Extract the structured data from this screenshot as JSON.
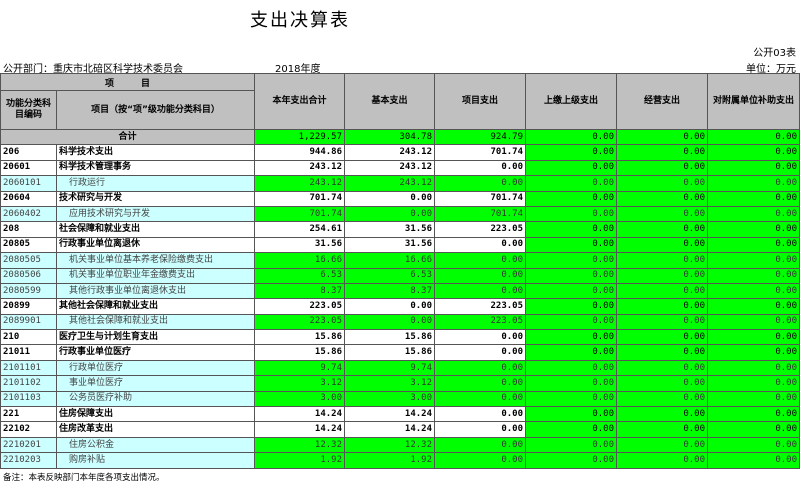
{
  "title": "支出决算表",
  "form_no": "公开03表",
  "department": "公开部门：重庆市北碚区科学技术委员会",
  "year": "2018年度",
  "unit": "单位：万元",
  "headers": {
    "item": "项　　　目",
    "code": "功能分类科目编码",
    "name": "项目（按“项”级功能分类科目）",
    "cols": [
      "本年支出合计",
      "基本支出",
      "项目支出",
      "上缴上级支出",
      "经营支出",
      "对附属单位补助支出"
    ]
  },
  "rows": [
    {
      "type": "total",
      "code": "",
      "name": "合计",
      "values": [
        "1,229.57",
        "304.78",
        "924.79",
        "0.00",
        "0.00",
        "0.00"
      ]
    },
    {
      "type": "cat",
      "code": "206",
      "name": "科学技术支出",
      "values": [
        "944.86",
        "243.12",
        "701.74",
        "0.00",
        "0.00",
        "0.00"
      ]
    },
    {
      "type": "cat",
      "code": "20601",
      "name": "科学技术管理事务",
      "values": [
        "243.12",
        "243.12",
        "0.00",
        "0.00",
        "0.00",
        "0.00"
      ]
    },
    {
      "type": "item",
      "code": "2060101",
      "name": "行政运行",
      "values": [
        "243.12",
        "243.12",
        "0.00",
        "0.00",
        "0.00",
        "0.00"
      ]
    },
    {
      "type": "cat",
      "code": "20604",
      "name": "技术研究与开发",
      "values": [
        "701.74",
        "0.00",
        "701.74",
        "0.00",
        "0.00",
        "0.00"
      ]
    },
    {
      "type": "item",
      "code": "2060402",
      "name": "应用技术研究与开发",
      "values": [
        "701.74",
        "0.00",
        "701.74",
        "0.00",
        "0.00",
        "0.00"
      ]
    },
    {
      "type": "cat",
      "code": "208",
      "name": "社会保障和就业支出",
      "values": [
        "254.61",
        "31.56",
        "223.05",
        "0.00",
        "0.00",
        "0.00"
      ]
    },
    {
      "type": "cat",
      "code": "20805",
      "name": "行政事业单位离退休",
      "values": [
        "31.56",
        "31.56",
        "0.00",
        "0.00",
        "0.00",
        "0.00"
      ]
    },
    {
      "type": "item",
      "code": "2080505",
      "name": "机关事业单位基本养老保险缴费支出",
      "values": [
        "16.66",
        "16.66",
        "0.00",
        "0.00",
        "0.00",
        "0.00"
      ]
    },
    {
      "type": "item",
      "code": "2080506",
      "name": "机关事业单位职业年金缴费支出",
      "values": [
        "6.53",
        "6.53",
        "0.00",
        "0.00",
        "0.00",
        "0.00"
      ]
    },
    {
      "type": "item",
      "code": "2080599",
      "name": "其他行政事业单位离退休支出",
      "values": [
        "8.37",
        "8.37",
        "0.00",
        "0.00",
        "0.00",
        "0.00"
      ]
    },
    {
      "type": "cat",
      "code": "20899",
      "name": "其他社会保障和就业支出",
      "values": [
        "223.05",
        "0.00",
        "223.05",
        "0.00",
        "0.00",
        "0.00"
      ]
    },
    {
      "type": "item",
      "code": "2089901",
      "name": "其他社会保障和就业支出",
      "values": [
        "223.05",
        "0.00",
        "223.05",
        "0.00",
        "0.00",
        "0.00"
      ]
    },
    {
      "type": "cat",
      "code": "210",
      "name": "医疗卫生与计划生育支出",
      "values": [
        "15.86",
        "15.86",
        "0.00",
        "0.00",
        "0.00",
        "0.00"
      ]
    },
    {
      "type": "cat",
      "code": "21011",
      "name": "行政事业单位医疗",
      "values": [
        "15.86",
        "15.86",
        "0.00",
        "0.00",
        "0.00",
        "0.00"
      ]
    },
    {
      "type": "item",
      "code": "2101101",
      "name": "行政单位医疗",
      "values": [
        "9.74",
        "9.74",
        "0.00",
        "0.00",
        "0.00",
        "0.00"
      ]
    },
    {
      "type": "item",
      "code": "2101102",
      "name": "事业单位医疗",
      "values": [
        "3.12",
        "3.12",
        "0.00",
        "0.00",
        "0.00",
        "0.00"
      ]
    },
    {
      "type": "item",
      "code": "2101103",
      "name": "公务员医疗补助",
      "values": [
        "3.00",
        "3.00",
        "0.00",
        "0.00",
        "0.00",
        "0.00"
      ]
    },
    {
      "type": "cat",
      "code": "221",
      "name": "住房保障支出",
      "values": [
        "14.24",
        "14.24",
        "0.00",
        "0.00",
        "0.00",
        "0.00"
      ]
    },
    {
      "type": "cat",
      "code": "22102",
      "name": "住房改革支出",
      "values": [
        "14.24",
        "14.24",
        "0.00",
        "0.00",
        "0.00",
        "0.00"
      ]
    },
    {
      "type": "item",
      "code": "2210201",
      "name": "住房公积金",
      "values": [
        "12.32",
        "12.32",
        "0.00",
        "0.00",
        "0.00",
        "0.00"
      ]
    },
    {
      "type": "item",
      "code": "2210203",
      "name": "购房补贴",
      "values": [
        "1.92",
        "1.92",
        "0.00",
        "0.00",
        "0.00",
        "0.00"
      ]
    }
  ],
  "note": "备注：本表反映部门本年度各项支出情况。"
}
